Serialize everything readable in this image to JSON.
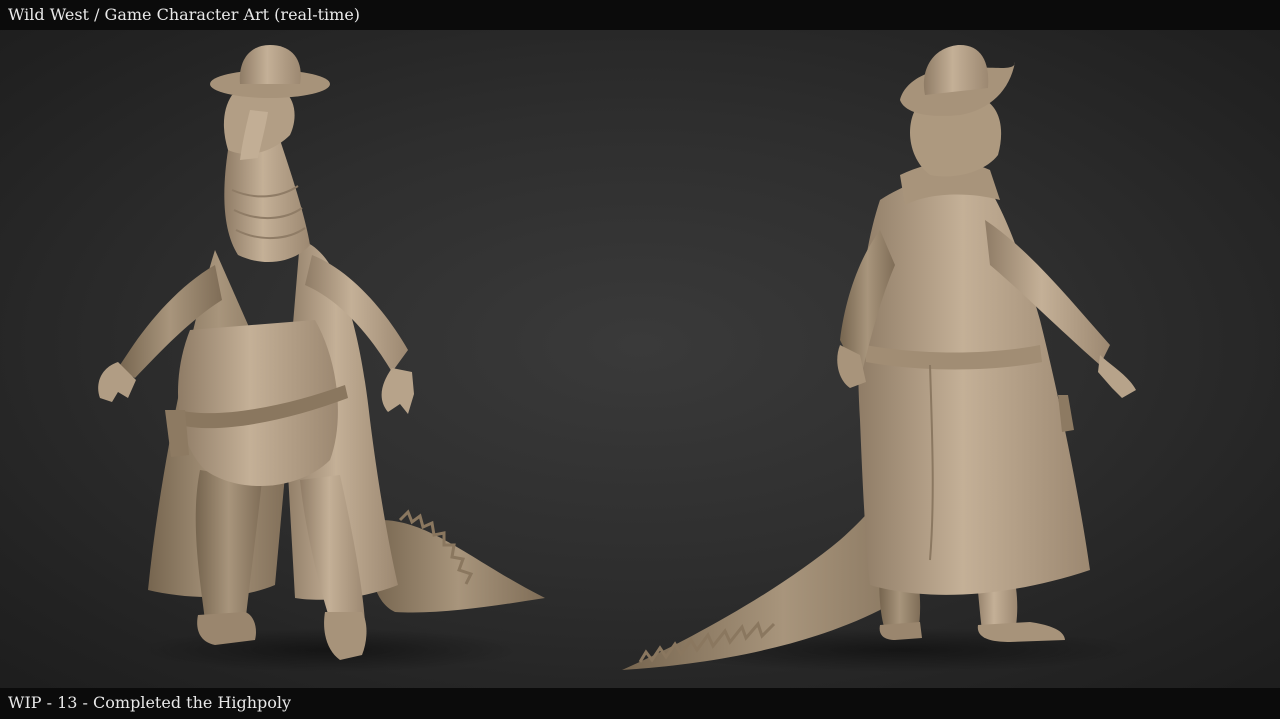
{
  "header": {
    "title": "Wild West / Game Character Art (real-time)"
  },
  "footer": {
    "caption": "WIP - 13 - Completed the Highpoly"
  },
  "render": {
    "background_color": "#2e2e2e",
    "clay_color": "#b9a58c",
    "bar_color": "#0b0b0b"
  }
}
